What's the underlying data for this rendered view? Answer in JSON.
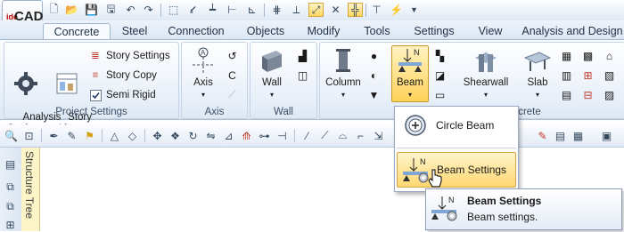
{
  "app": {
    "logo_small": "ide",
    "logo_big": "CAD"
  },
  "quick_access": {
    "icons": [
      "new-file-icon",
      "open-folder-icon",
      "save-icon",
      "save-as-icon",
      "undo-icon",
      "redo-icon",
      "select-icon",
      "move-icon",
      "align-icon",
      "line-icon",
      "grid-snap-icon",
      "snap-node-icon",
      "snap-active-icon",
      "snap-perpendicular-icon",
      "snap-midpoint-icon",
      "lightning-icon",
      "dropdown-arrow-icon"
    ]
  },
  "tabs": [
    "Concrete",
    "Steel",
    "Connection",
    "Objects",
    "Modify",
    "Tools",
    "Settings",
    "View",
    "Analysis and Design"
  ],
  "active_tab": "Concrete",
  "ribbon": {
    "project_settings": {
      "label": "Project Settings",
      "analysis_settings": "Analysis\nSettings",
      "story_list": "Story\nList",
      "story_settings": "Story Settings",
      "story_copy": "Story Copy",
      "semi_rigid": "Semi Rigid"
    },
    "axis": {
      "label": "Axis",
      "button": "Axis"
    },
    "wall": {
      "label": "Wall",
      "button": "Wall"
    },
    "concrete": {
      "label": "Concrete",
      "label_visible": "crete",
      "column": "Column",
      "beam": "Beam",
      "shearwall": "Shearwall",
      "slab": "Slab"
    }
  },
  "dropdown": {
    "items": [
      {
        "label": "Circle Beam",
        "icon": "circle-beam-icon"
      },
      {
        "label": "Beam Settings",
        "icon": "beam-settings-icon"
      }
    ]
  },
  "tooltip": {
    "title": "Beam Settings",
    "text": "Beam settings."
  },
  "side_panel": {
    "label": "Structure Tree"
  },
  "beam_icon_letter": "N",
  "colors": {
    "accent": "#ffd35a",
    "ribbon": "#dde8f5",
    "tab_active": "#f7fbff",
    "panel": "#fdf4c8"
  }
}
